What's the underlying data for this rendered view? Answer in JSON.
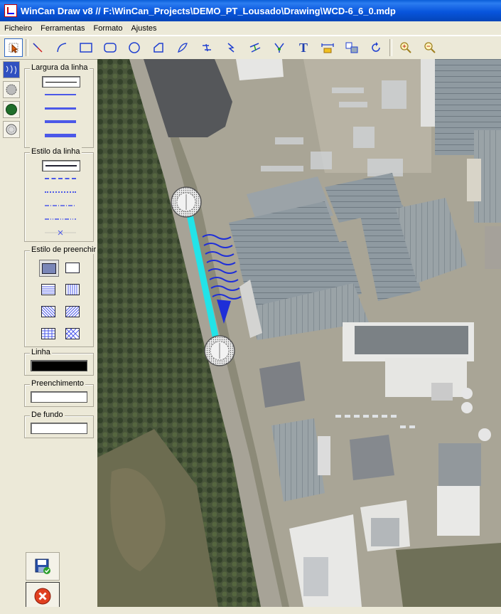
{
  "window": {
    "title": "WinCan Draw v8 // F:\\WinCan_Projects\\DEMO_PT_Lousado\\Drawing\\WCD-6_6_0.mdp"
  },
  "menu": [
    "Ficheiro",
    "Ferramentas",
    "Formato",
    "Ajustes"
  ],
  "toolbar": {
    "tools": [
      "select-tool",
      "line-tool",
      "arc-tool",
      "rectangle-tool",
      "rounded-rectangle-tool",
      "ellipse-tool",
      "polygon-tool",
      "freehand-tool",
      "pipe-tool",
      "flow-arrow-tool",
      "connector-tool",
      "branch-tool",
      "text-tool",
      "dimension-tool",
      "symbol-tool",
      "rotate-tool",
      "zoom-in-tool",
      "zoom-out-tool"
    ],
    "text_tool_glyph": "T"
  },
  "panel": {
    "line_width": {
      "title": "Largura da linha",
      "widths": [
        1,
        2,
        3,
        4,
        5
      ]
    },
    "line_style": {
      "title": "Estilo da linha",
      "styles": [
        "solid",
        "dashed",
        "dotted",
        "dash-dot",
        "dash-dot-dot",
        "none"
      ]
    },
    "fill_style": {
      "title": "Estilo de preenchir"
    },
    "line_color": {
      "title": "Linha",
      "color": "#000000"
    },
    "fill_color": {
      "title": "Preenchimento",
      "color": "#ffffff"
    },
    "background_color": {
      "title": "De fundo",
      "color": "#ffffff"
    }
  },
  "drawing": {
    "pipe_color": "#22e3e8",
    "flow_color": "#1e2ed8",
    "manhole_count": 2
  }
}
